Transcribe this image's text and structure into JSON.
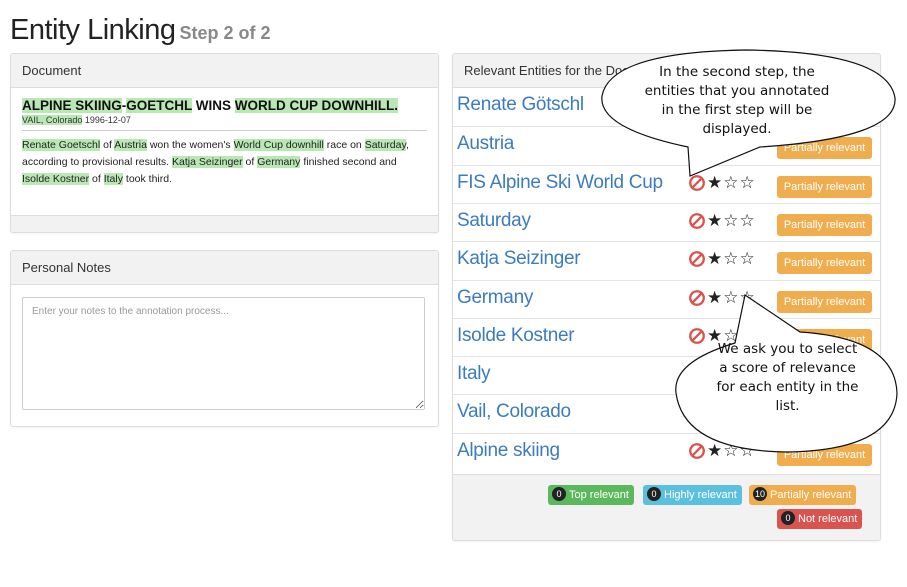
{
  "page": {
    "title": "Entity Linking",
    "step": "Step 2 of 2"
  },
  "document": {
    "heading": "Document",
    "headline_parts": [
      {
        "text": "ALPINE SKIING",
        "hl": true
      },
      {
        "text": "-",
        "hl": false
      },
      {
        "text": "GOETCHL",
        "hl": true
      },
      {
        "text": " WINS ",
        "hl": false
      },
      {
        "text": "WORLD CUP DOWNHILL.",
        "hl": true
      }
    ],
    "dateline_parts": [
      {
        "text": "VAIL, Colorado",
        "hl": true
      },
      {
        "text": " 1996-12-07",
        "hl": false
      }
    ],
    "body_parts": [
      {
        "text": "Renate Goetschl",
        "hl": true
      },
      {
        "text": " of ",
        "hl": false
      },
      {
        "text": "Austria",
        "hl": true
      },
      {
        "text": " won the women's ",
        "hl": false
      },
      {
        "text": "World Cup downhill",
        "hl": true
      },
      {
        "text": " race on ",
        "hl": false
      },
      {
        "text": "Saturday",
        "hl": true
      },
      {
        "text": ", according to provisional results. ",
        "hl": false
      },
      {
        "text": "Katja Seizinger",
        "hl": true
      },
      {
        "text": " of ",
        "hl": false
      },
      {
        "text": "Germany",
        "hl": true
      },
      {
        "text": " finished second and ",
        "hl": false
      },
      {
        "text": "Isolde Kostner",
        "hl": true
      },
      {
        "text": " of ",
        "hl": false
      },
      {
        "text": "Italy",
        "hl": true
      },
      {
        "text": " took third.",
        "hl": false
      }
    ]
  },
  "notes": {
    "heading": "Personal Notes",
    "placeholder": "Enter your notes to the annotation process...",
    "value": ""
  },
  "entities": {
    "heading": "Relevant Entities for the Document",
    "items": [
      {
        "name": "Renate Götschl",
        "rating": 1,
        "relevance": "Partially relevant"
      },
      {
        "name": "Austria",
        "rating": 1,
        "relevance": "Partially relevant"
      },
      {
        "name": "FIS Alpine Ski World Cup",
        "rating": 1,
        "relevance": "Partially relevant"
      },
      {
        "name": "Saturday",
        "rating": 1,
        "relevance": "Partially relevant"
      },
      {
        "name": "Katja Seizinger",
        "rating": 1,
        "relevance": "Partially relevant"
      },
      {
        "name": "Germany",
        "rating": 1,
        "relevance": "Partially relevant"
      },
      {
        "name": "Isolde Kostner",
        "rating": 1,
        "relevance": "Partially relevant"
      },
      {
        "name": "Italy",
        "rating": 1,
        "relevance": "Partially relevant"
      },
      {
        "name": "Vail, Colorado",
        "rating": 1,
        "relevance": "Partially relevant"
      },
      {
        "name": "Alpine skiing",
        "rating": 1,
        "relevance": "Partially relevant"
      }
    ],
    "legend": {
      "top": {
        "count": "0",
        "label": "Top relevant"
      },
      "high": {
        "count": "0",
        "label": "Highly relevant"
      },
      "partial": {
        "count": "10",
        "label": "Partially relevant"
      },
      "not": {
        "count": "0",
        "label": "Not relevant"
      }
    }
  },
  "callouts": {
    "first": [
      "In the second step, the",
      "entities that you annotated",
      "in the first step will be",
      "displayed."
    ],
    "second": [
      "We ask you to select",
      "a score of relevance",
      "for each entity in the",
      "list."
    ]
  },
  "colors": {
    "highlight": "#b9e8b5",
    "entity_link": "#3b7cbf",
    "partial": "#f0ad4e",
    "top": "#5cb85c",
    "high": "#5bc0de",
    "not": "#d9534f",
    "no_icon": "#d9534f"
  }
}
